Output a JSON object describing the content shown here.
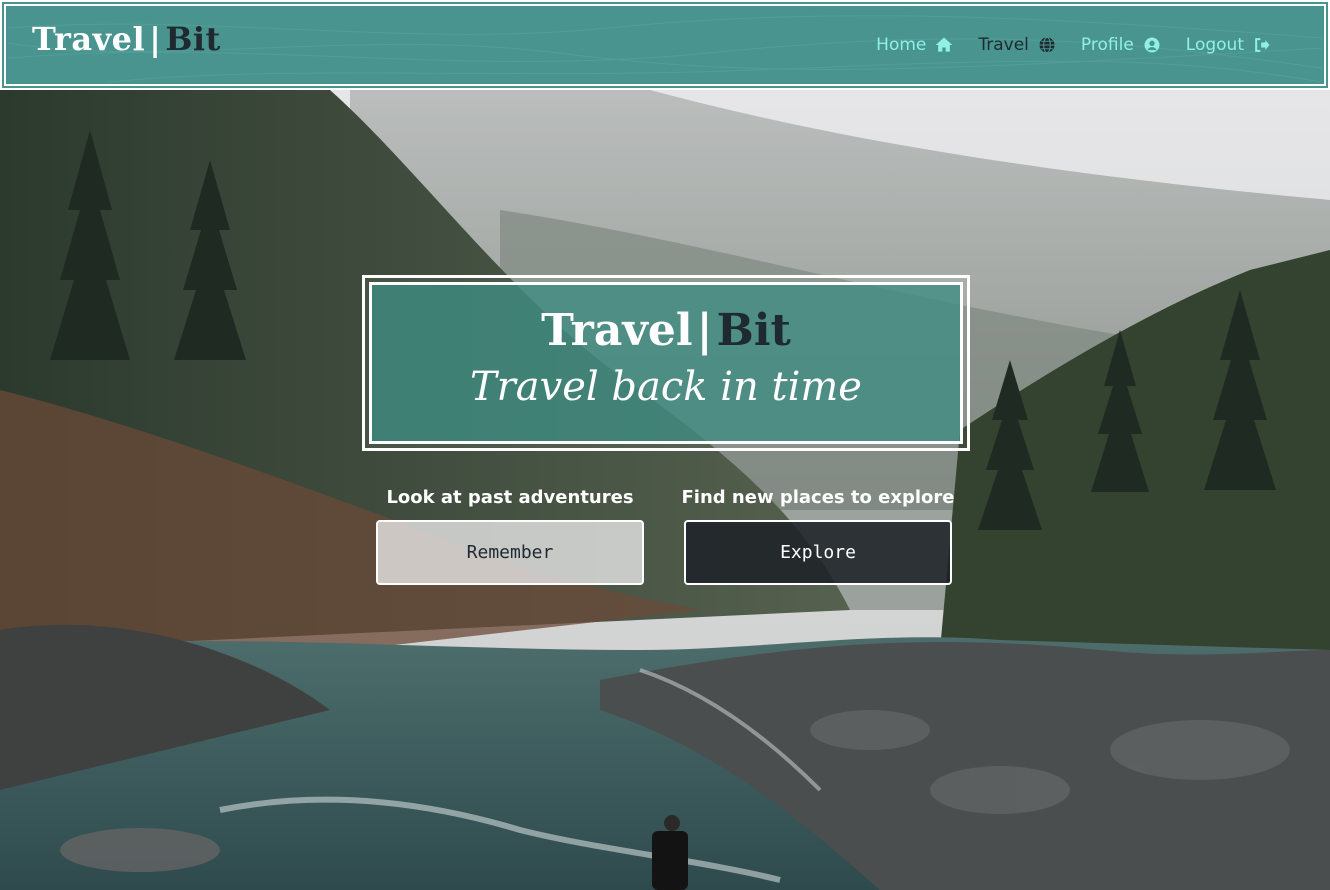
{
  "nav": {
    "brand": {
      "part1": "Travel",
      "separator": "|",
      "part2": "Bit"
    },
    "links": [
      {
        "label": "Home",
        "icon": "home-icon",
        "active": false
      },
      {
        "label": "Travel",
        "icon": "globe-icon",
        "active": true
      },
      {
        "label": "Profile",
        "icon": "user-circle-icon",
        "active": false
      },
      {
        "label": "Logout",
        "icon": "sign-out-icon",
        "active": false
      }
    ]
  },
  "hero": {
    "brand": {
      "part1": "Travel",
      "separator": "|",
      "part2": "Bit"
    },
    "tagline": "Travel back in time",
    "actions": [
      {
        "caption": "Look at past adventures",
        "button": "Remember",
        "style": "light"
      },
      {
        "caption": "Find new places to explore",
        "button": "Explore",
        "style": "dark"
      }
    ]
  },
  "colors": {
    "nav_bg": "#4a948f",
    "nav_link": "#8ff0e4",
    "nav_link_active": "#1e2a30",
    "brand_accent": "#1e2a30"
  }
}
